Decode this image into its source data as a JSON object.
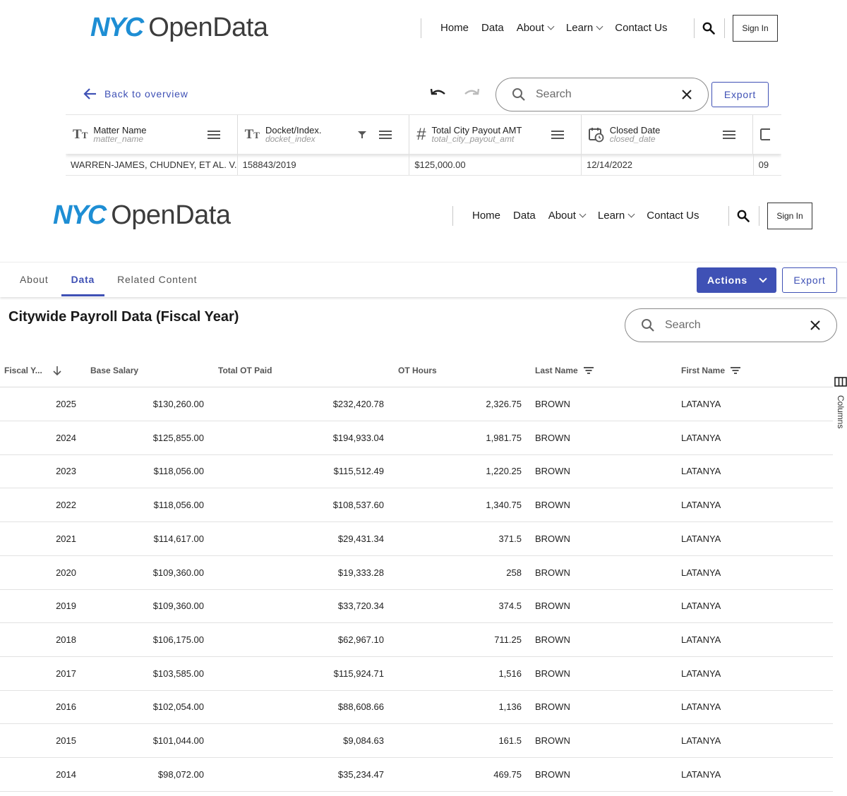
{
  "header_top": {
    "logo_nyc": "NYC",
    "logo_open": "OpenData",
    "nav": [
      "Home",
      "Data",
      "About",
      "Learn",
      "Contact Us"
    ],
    "sign_in": "Sign In"
  },
  "toolbar_top": {
    "back": "Back to overview",
    "search_placeholder": "Search",
    "export": "Export"
  },
  "grid_top": {
    "columns": [
      {
        "name": "Matter Name",
        "field": "matter_name",
        "type": "text"
      },
      {
        "name": "Docket/Index.",
        "field": "docket_index",
        "type": "text"
      },
      {
        "name": "Total City Payout AMT",
        "field": "total_city_payout_amt",
        "type": "number"
      },
      {
        "name": "Closed Date",
        "field": "closed_date",
        "type": "date"
      }
    ],
    "row": [
      "WARREN-JAMES, CHUDNEY, ET AL. V...",
      "158843/2019",
      "$125,000.00",
      "12/14/2022",
      "09"
    ]
  },
  "header_main": {
    "logo_nyc": "NYC",
    "logo_open": "OpenData",
    "nav": [
      "Home",
      "Data",
      "About",
      "Learn",
      "Contact Us"
    ],
    "sign_in": "Sign In"
  },
  "tabs": {
    "items": [
      "About",
      "Data",
      "Related Content"
    ],
    "active": "Data",
    "actions": "Actions",
    "export": "Export"
  },
  "dataset": {
    "title": "Citywide Payroll Data (Fiscal Year)",
    "search_placeholder": "Search",
    "columns_label": "Columns",
    "headers": [
      "Fiscal Y...",
      "Base Salary",
      "Total OT Paid",
      "OT Hours",
      "Last Name",
      "First Name"
    ],
    "rows": [
      [
        "2025",
        "$130,260.00",
        "$232,420.78",
        "2,326.75",
        "BROWN",
        "LATANYA"
      ],
      [
        "2024",
        "$125,855.00",
        "$194,933.04",
        "1,981.75",
        "BROWN",
        "LATANYA"
      ],
      [
        "2023",
        "$118,056.00",
        "$115,512.49",
        "1,220.25",
        "BROWN",
        "LATANYA"
      ],
      [
        "2022",
        "$118,056.00",
        "$108,537.60",
        "1,340.75",
        "BROWN",
        "LATANYA"
      ],
      [
        "2021",
        "$114,617.00",
        "$29,431.34",
        "371.5",
        "BROWN",
        "LATANYA"
      ],
      [
        "2020",
        "$109,360.00",
        "$19,333.28",
        "258",
        "BROWN",
        "LATANYA"
      ],
      [
        "2019",
        "$109,360.00",
        "$33,720.34",
        "374.5",
        "BROWN",
        "LATANYA"
      ],
      [
        "2018",
        "$106,175.00",
        "$62,967.10",
        "711.25",
        "BROWN",
        "LATANYA"
      ],
      [
        "2017",
        "$103,585.00",
        "$115,924.71",
        "1,516",
        "BROWN",
        "LATANYA"
      ],
      [
        "2016",
        "$102,054.00",
        "$88,608.66",
        "1,136",
        "BROWN",
        "LATANYA"
      ],
      [
        "2015",
        "$101,044.00",
        "$9,084.63",
        "161.5",
        "BROWN",
        "LATANYA"
      ],
      [
        "2014",
        "$98,072.00",
        "$35,234.47",
        "469.75",
        "BROWN",
        "LATANYA"
      ]
    ]
  },
  "colors": {
    "accent": "#3f51b5",
    "logo_blue": "#1e8ed4"
  }
}
